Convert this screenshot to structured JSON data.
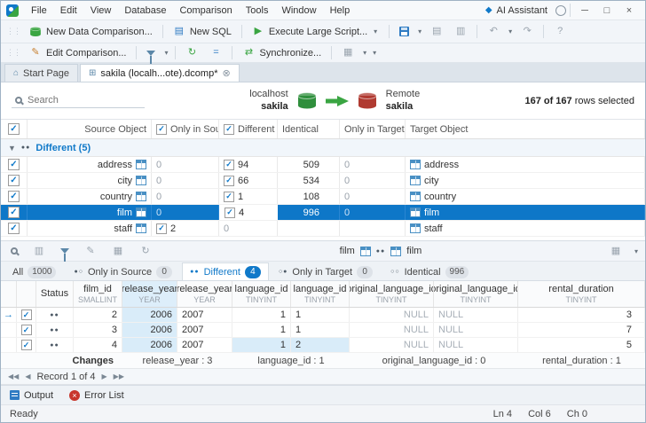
{
  "menu_bar": {
    "items": [
      "File",
      "Edit",
      "View",
      "Database",
      "Comparison",
      "Tools",
      "Window",
      "Help"
    ],
    "ai_assistant": "AI Assistant"
  },
  "toolbar_main": {
    "new_data_comparison": "New Data Comparison...",
    "new_sql": "New SQL",
    "execute_large_script": "Execute Large Script..."
  },
  "toolbar_comparison": {
    "edit_comparison": "Edit Comparison...",
    "synchronize": "Synchronize..."
  },
  "document_tabs": {
    "start_page": "Start Page",
    "active_doc": "sakila (localh...ote).dcomp*"
  },
  "comparison_header": {
    "search_placeholder": "Search",
    "source_host": "localhost",
    "source_db": "sakila",
    "target_host": "Remote",
    "target_db": "sakila",
    "selection_bold": "167 of 167",
    "selection_rest": "rows selected"
  },
  "objects_grid": {
    "col_source_object": "Source Object",
    "col_only_in_source": "Only in Source",
    "col_different": "Different",
    "col_identical": "Identical",
    "col_only_in_target": "Only in Target",
    "col_target_object": "Target Object",
    "group_label": "Different (5)",
    "rows": [
      {
        "source": "address",
        "only_in_source": "0",
        "different": "94",
        "identical": "509",
        "only_in_target": "0",
        "target": "address"
      },
      {
        "source": "city",
        "only_in_source": "0",
        "different": "66",
        "identical": "534",
        "only_in_target": "0",
        "target": "city"
      },
      {
        "source": "country",
        "only_in_source": "0",
        "different": "1",
        "identical": "108",
        "only_in_target": "0",
        "target": "country"
      },
      {
        "source": "film",
        "only_in_source": "0",
        "different": "4",
        "identical": "996",
        "only_in_target": "0",
        "target": "film"
      },
      {
        "source": "staff",
        "only_in_source": "2",
        "different": "0",
        "identical": "",
        "only_in_target": "",
        "target": "staff"
      }
    ]
  },
  "results_pane": {
    "context_left": "film",
    "context_right": "film",
    "tabs": {
      "all_label": "All",
      "all_count": "1000",
      "ois_label": "Only in Source",
      "ois_count": "0",
      "diff_label": "Different",
      "diff_count": "4",
      "oit_label": "Only in Target",
      "oit_count": "0",
      "ident_label": "Identical",
      "ident_count": "996"
    },
    "columns": {
      "status": "Status",
      "film_id_name": "film_id",
      "film_id_type": "SMALLINT",
      "release_year_name": "release_year",
      "release_year_type": "YEAR",
      "language_id_name": "language_id",
      "language_id_type": "TINYINT",
      "original_language_id_name": "original_language_id",
      "original_language_id_type": "TINYINT",
      "rental_duration_name": "rental_duration",
      "rental_duration_type": "TINYINT"
    },
    "rows": [
      {
        "film_id": "2",
        "release_year_src": "2006",
        "release_year_tgt": "2007",
        "language_id_src": "1",
        "language_id_tgt": "1",
        "original_language_id_src": "NULL",
        "original_language_id_tgt": "NULL",
        "rental_duration": "3"
      },
      {
        "film_id": "3",
        "release_year_src": "2006",
        "release_year_tgt": "2007",
        "language_id_src": "1",
        "language_id_tgt": "1",
        "original_language_id_src": "NULL",
        "original_language_id_tgt": "NULL",
        "rental_duration": "7"
      },
      {
        "film_id": "4",
        "release_year_src": "2006",
        "release_year_tgt": "2007",
        "language_id_src": "1",
        "language_id_tgt": "2",
        "original_language_id_src": "NULL",
        "original_language_id_tgt": "NULL",
        "rental_duration": "5"
      }
    ],
    "changes": {
      "label": "Changes",
      "release_year": "release_year : 3",
      "language_id": "language_id : 1",
      "original_language_id": "original_language_id : 0",
      "rental_duration": "rental_duration : 1"
    },
    "record_navigator": "Record 1 of 4"
  },
  "bottom_bar": {
    "output": "Output",
    "error_list": "Error List"
  },
  "status_bar": {
    "state": "Ready",
    "ln": "Ln 4",
    "col": "Col 6",
    "ch": "Ch 0"
  }
}
